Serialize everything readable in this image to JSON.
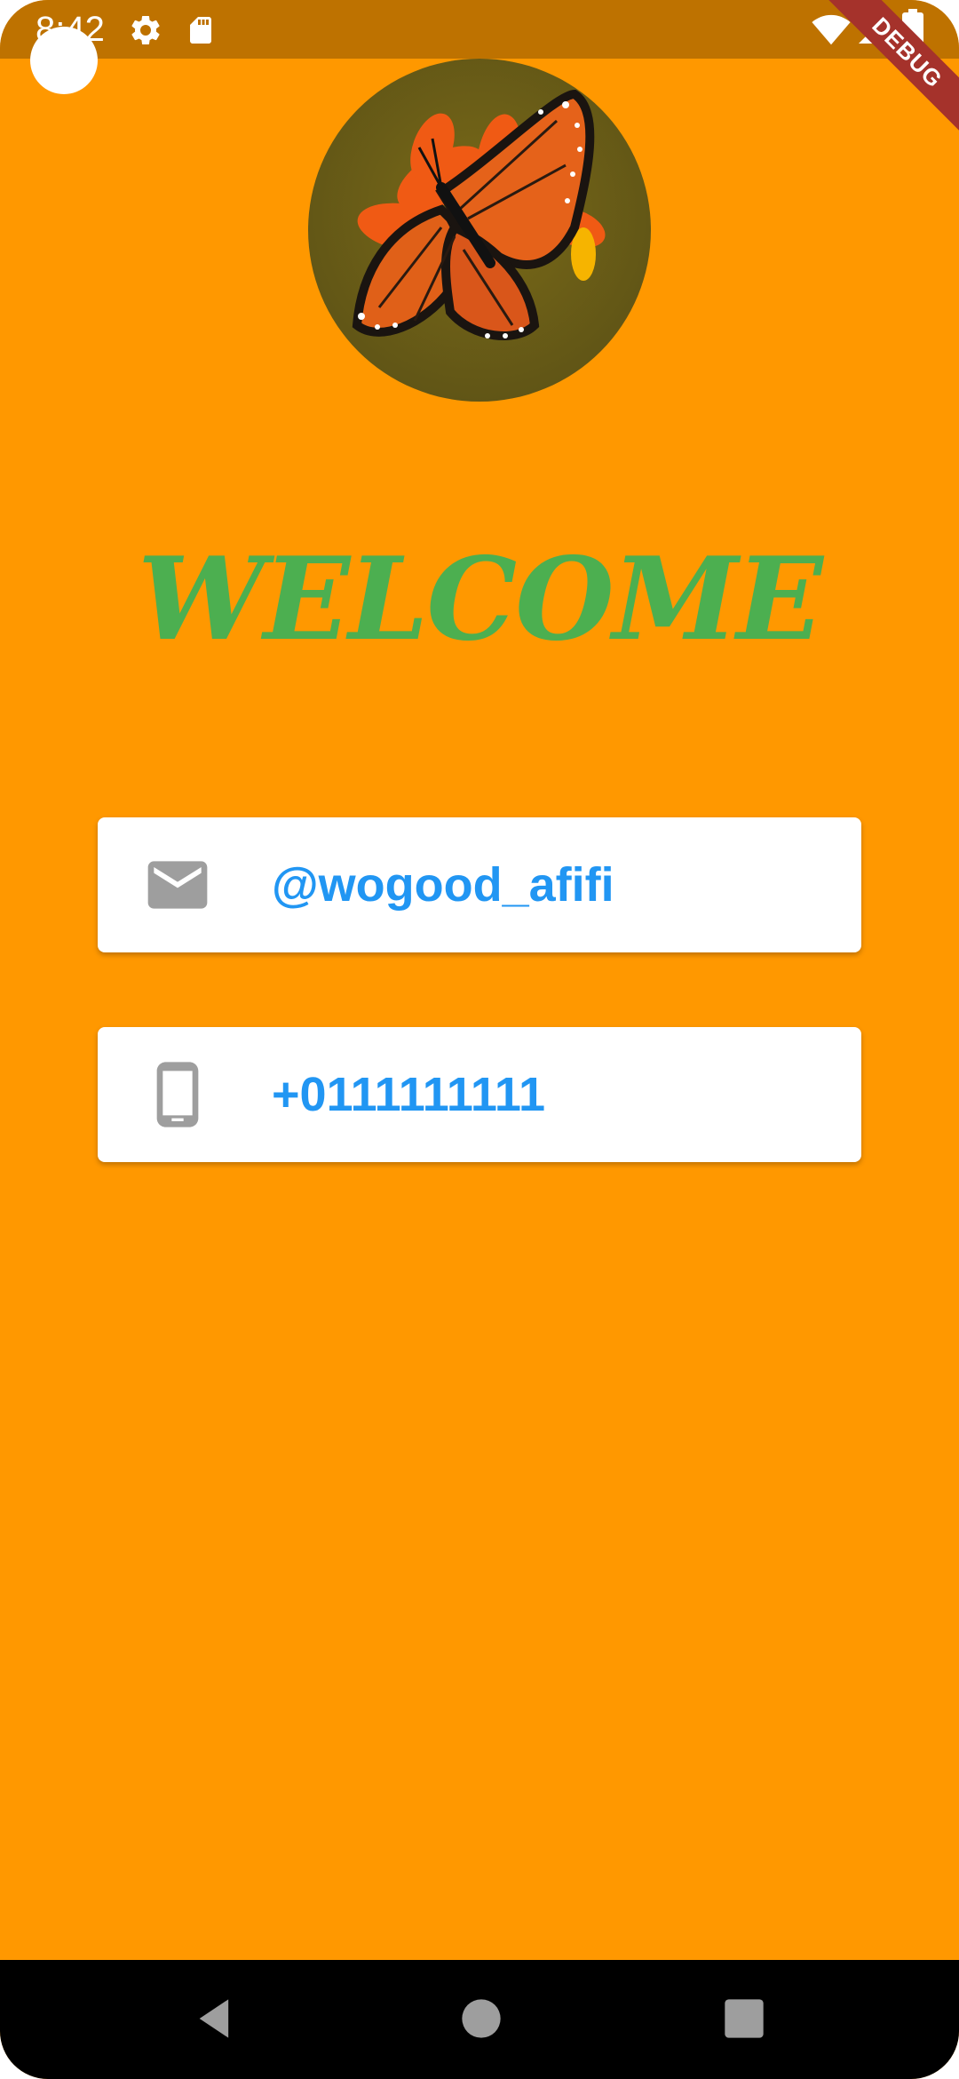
{
  "status_bar": {
    "time": "8:42",
    "left_icons": [
      "gear-icon",
      "sd-card-icon"
    ],
    "right_icons": [
      "wifi-icon",
      "signal-icon",
      "battery-icon"
    ],
    "debug_label": "DEBUG"
  },
  "profile": {
    "avatar_icon": "butterfly-photo",
    "greeting": "WELCOME"
  },
  "contact": {
    "email_icon": "mail-icon",
    "email": "@wogood_afifi",
    "phone_icon": "phone-icon",
    "phone": "+0111111111"
  },
  "nav_bar": {
    "buttons": [
      "back-icon",
      "home-icon",
      "recents-icon"
    ]
  },
  "colors": {
    "background": "#FF9800",
    "status_bar": "#BE7200",
    "greeting": "#4CAF50",
    "card_text": "#2196F3",
    "card_icon": "#9E9E9E",
    "debug_banner": "#A5322B"
  }
}
